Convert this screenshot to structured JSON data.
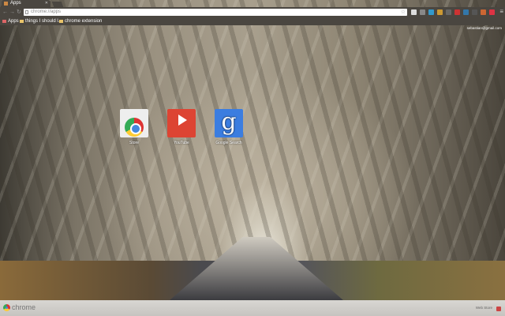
{
  "tab": {
    "title": "Apps"
  },
  "omnibox": {
    "url": "chrome://apps"
  },
  "bookmarks": [
    {
      "label": "Apps"
    },
    {
      "label": "things I should l..."
    },
    {
      "label": "chrome extension"
    }
  ],
  "user": {
    "email": "sebastian@gmail.com"
  },
  "apps": [
    {
      "label": "Store"
    },
    {
      "label": "YouTube"
    },
    {
      "label": "Google Search",
      "glyph": "g"
    }
  ],
  "footer": {
    "brand": "chrome",
    "web_store": "Web Store"
  },
  "extension_colors": [
    "#ddd",
    "#888",
    "#39c",
    "#c93",
    "#666",
    "#c33",
    "#37a",
    "#555",
    "#c63",
    "#d34"
  ]
}
